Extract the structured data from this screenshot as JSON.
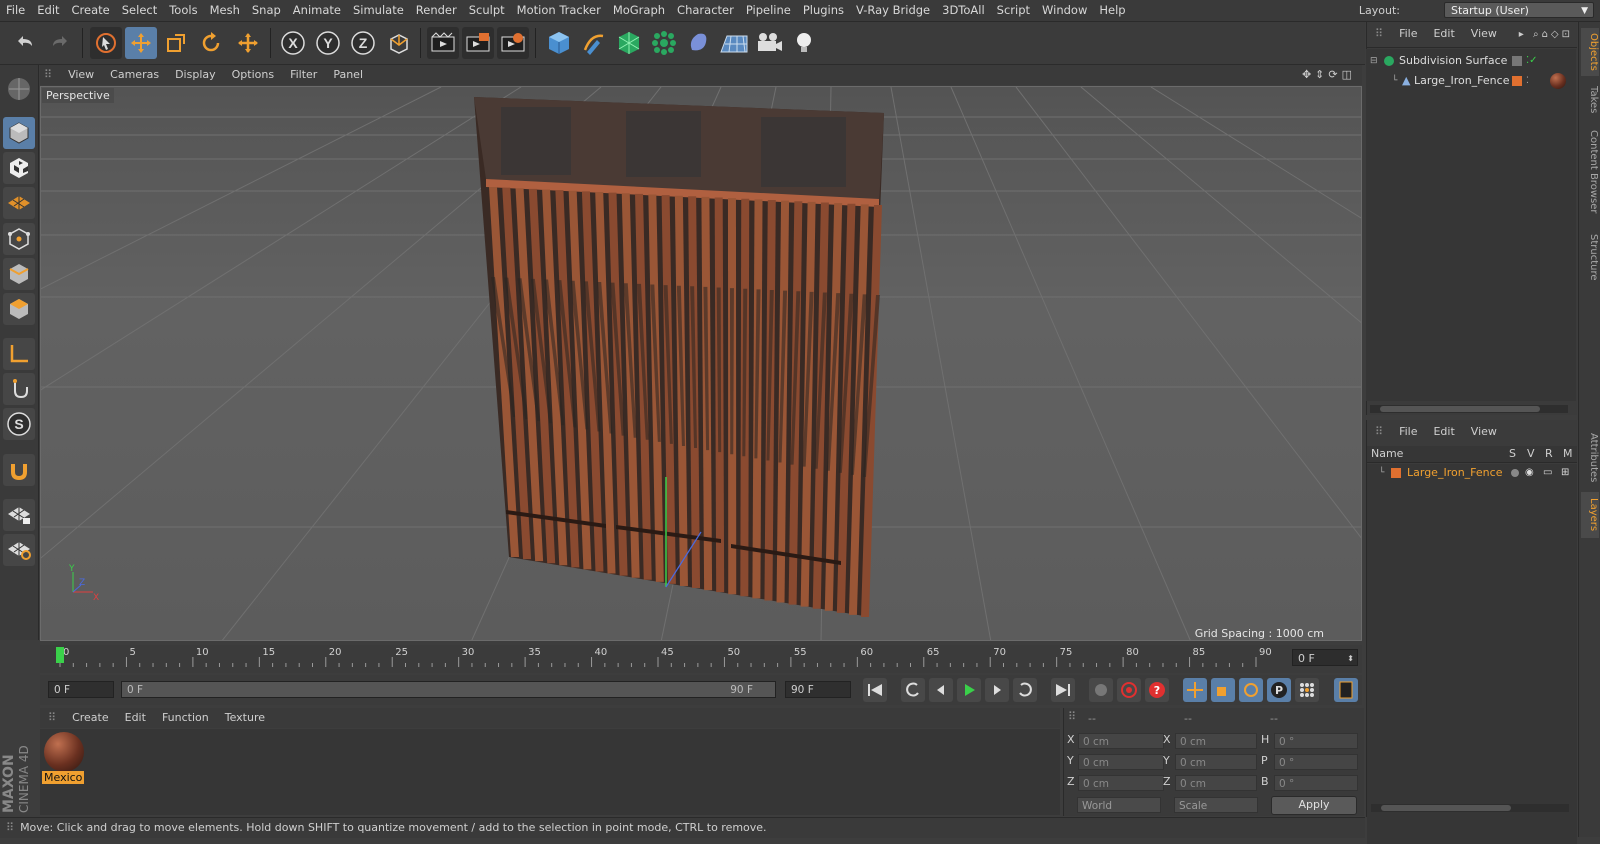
{
  "menubar": {
    "items": [
      "File",
      "Edit",
      "Create",
      "Select",
      "Tools",
      "Mesh",
      "Snap",
      "Animate",
      "Simulate",
      "Render",
      "Sculpt",
      "Motion Tracker",
      "MoGraph",
      "Character",
      "Pipeline",
      "Plugins",
      "V-Ray Bridge",
      "3DToAll",
      "Script",
      "Window",
      "Help"
    ],
    "layout_label": "Layout:",
    "layout_value": "Startup (User)"
  },
  "toolbar": {
    "icons": [
      "undo-icon",
      "redo-icon",
      "select-arrow-icon",
      "move-icon",
      "scale-icon",
      "rotate-icon",
      "live-select-icon",
      "x-axis-icon",
      "y-axis-icon",
      "z-axis-icon",
      "coordinate-system-icon",
      "render-view-icon",
      "render-picture-viewer-icon",
      "render-settings-icon",
      "cube-icon",
      "pen-icon",
      "subdivision-icon",
      "mograph-cloner-icon",
      "deformer-icon",
      "floor-icon",
      "camera-icon",
      "light-icon"
    ],
    "axis_labels": [
      "X",
      "Y",
      "Z"
    ]
  },
  "viewport": {
    "menu": [
      "View",
      "Cameras",
      "Display",
      "Options",
      "Filter",
      "Panel"
    ],
    "camera_label": "Perspective",
    "grid_spacing": "Grid Spacing : 1000 cm",
    "axis_labels": {
      "y": "Y",
      "z": "Z",
      "x": "X"
    }
  },
  "timeline": {
    "ticks": [
      "0",
      "5",
      "10",
      "15",
      "20",
      "25",
      "30",
      "35",
      "40",
      "45",
      "50",
      "55",
      "60",
      "65",
      "70",
      "75",
      "80",
      "85",
      "90"
    ],
    "current_frame": "0 F"
  },
  "transport": {
    "start_field": "0 F",
    "range_start": "0 F",
    "range_end": "90 F",
    "end_field": "90 F"
  },
  "material_manager": {
    "menu": [
      "Create",
      "Edit",
      "Function",
      "Texture"
    ],
    "materials": [
      {
        "name": "Mexico"
      }
    ]
  },
  "coordinates": {
    "header": [
      "--",
      "--",
      "--"
    ],
    "rows": [
      {
        "l1": "X",
        "v1": "0 cm",
        "l2": "X",
        "v2": "0 cm",
        "l3": "H",
        "v3": "0 °"
      },
      {
        "l1": "Y",
        "v1": "0 cm",
        "l2": "Y",
        "v2": "0 cm",
        "l3": "P",
        "v3": "0 °"
      },
      {
        "l1": "Z",
        "v1": "0 cm",
        "l2": "Z",
        "v2": "0 cm",
        "l3": "B",
        "v3": "0 °"
      }
    ],
    "mode_select": "World",
    "size_select": "Scale",
    "apply": "Apply"
  },
  "status": "Move: Click and drag to move elements. Hold down SHIFT to quantize movement / add to the selection in point mode, CTRL to remove.",
  "object_manager": {
    "menu": [
      "File",
      "Edit",
      "View"
    ],
    "objects": [
      {
        "name": "Subdivision Surface",
        "level": 0
      },
      {
        "name": "Large_Iron_Fence",
        "level": 1
      }
    ]
  },
  "layer_manager": {
    "menu": [
      "File",
      "Edit",
      "View"
    ],
    "columns": [
      "Name",
      "S",
      "V",
      "R",
      "M"
    ],
    "layers": [
      {
        "name": "Large_Iron_Fence"
      }
    ]
  },
  "side_tabs": [
    "Objects",
    "Takes",
    "Content Browser",
    "Structure",
    "Attributes",
    "Layers"
  ],
  "branding": {
    "line1": "MAXON",
    "line2": "CINEMA 4D"
  },
  "colors": {
    "accent": "#f0a030",
    "selected": "#5a7fa8",
    "rust": "#8a4a30"
  }
}
